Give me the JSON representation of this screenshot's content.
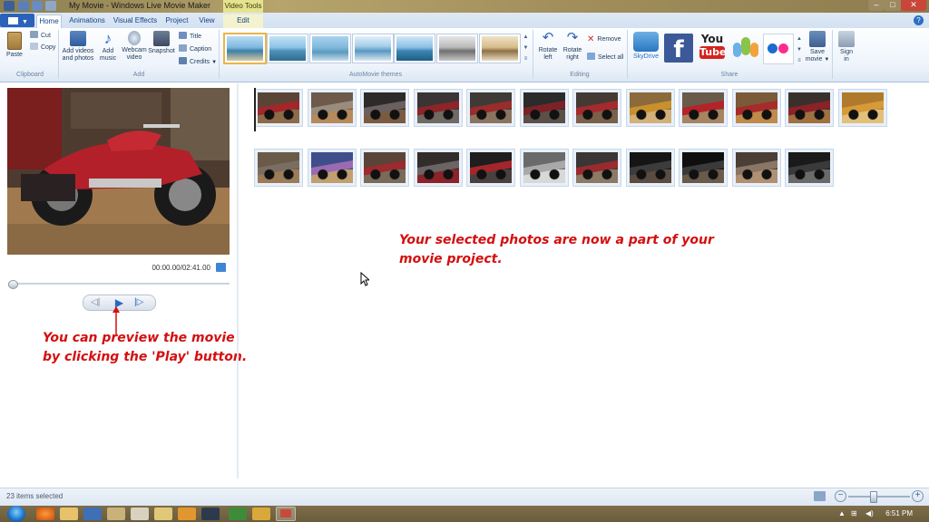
{
  "window": {
    "title": "My Movie - Windows Live Movie Maker",
    "contextual_tab_group": "Video Tools",
    "controls": [
      "–",
      "□",
      "✕"
    ]
  },
  "tabs": {
    "items": [
      {
        "label": "Home",
        "active": true
      },
      {
        "label": "Animations"
      },
      {
        "label": "Visual Effects"
      },
      {
        "label": "Project"
      },
      {
        "label": "View"
      },
      {
        "label": "Edit"
      }
    ],
    "help": "?"
  },
  "ribbon": {
    "clipboard": {
      "group_label": "Clipboard",
      "paste": "Paste",
      "cut": "Cut",
      "copy": "Copy"
    },
    "add": {
      "group_label": "Add",
      "add_videos_line1": "Add videos",
      "add_videos_line2": "and photos",
      "add_music_line1": "Add",
      "add_music_line2": "music",
      "webcam_line1": "Webcam",
      "webcam_line2": "video",
      "snapshot": "Snapshot",
      "title": "Title",
      "caption": "Caption",
      "credits": "Credits"
    },
    "themes": {
      "group_label": "AutoMovie themes",
      "scroll": [
        "▲",
        "▼",
        "≡"
      ]
    },
    "editing": {
      "group_label": "Editing",
      "rotate_left_line1": "Rotate",
      "rotate_left_line2": "left",
      "rotate_right_line1": "Rotate",
      "rotate_right_line2": "right",
      "remove": "Remove",
      "select_all": "Select all"
    },
    "share": {
      "group_label": "Share",
      "skydrive": "SkyDrive",
      "facebook": "f",
      "youtube_line1": "You",
      "youtube_line2": "Tube",
      "save_movie_line1": "Save",
      "save_movie_line2": "movie",
      "sign_in_line1": "Sign",
      "sign_in_line2": "in"
    }
  },
  "preview": {
    "timecode": "00:00.00/02:41.00",
    "play_symbol": "▶",
    "prev_symbol": "◁|",
    "next_symbol": "|▷",
    "seek_position": 0
  },
  "storyboard": {
    "row1_count": 12,
    "row2_count": 11
  },
  "annotations": {
    "selected_line1": "Your selected photos are now a part of your",
    "selected_line2": "movie project.",
    "preview_line1": "You can preview the movie",
    "preview_line2": "by clicking the 'Play' button."
  },
  "status": {
    "items_selected": "23 items selected"
  },
  "taskbar": {
    "clock": "6:51 PM"
  },
  "colors": {
    "annotation": "#d40f0f",
    "ribbon_text": "#1e395b",
    "accent": "#2a62bb"
  }
}
